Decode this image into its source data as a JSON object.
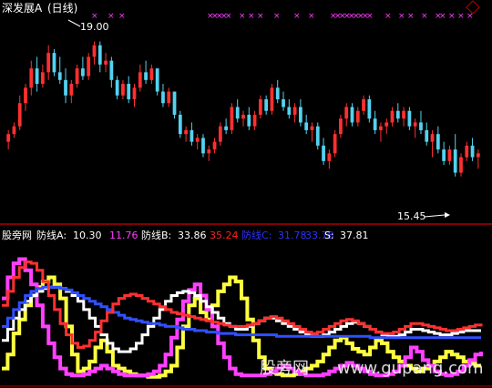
{
  "header": {
    "title": "深发展A",
    "period": "(日线)"
  },
  "chart_data": [
    {
      "type": "candlestick",
      "annotations": {
        "high_label": "19.00",
        "low_label": "15.45"
      },
      "markers": "×",
      "colors": {
        "up": "#ff3030",
        "down": "#54d2f0",
        "marker": "#ff3cff"
      },
      "yrange": [
        15.0,
        19.6
      ],
      "candles": [
        [
          16.4,
          16.7,
          16.2,
          16.6
        ],
        [
          16.6,
          16.9,
          16.5,
          16.8
        ],
        [
          16.8,
          17.6,
          16.7,
          17.4
        ],
        [
          17.4,
          17.9,
          17.2,
          17.8
        ],
        [
          17.8,
          18.5,
          17.6,
          18.3
        ],
        [
          18.3,
          18.6,
          17.7,
          17.9
        ],
        [
          17.9,
          18.4,
          17.8,
          18.2
        ],
        [
          18.2,
          18.9,
          18.0,
          18.7
        ],
        [
          18.7,
          18.8,
          18.1,
          18.2
        ],
        [
          18.2,
          18.6,
          17.9,
          18.0
        ],
        [
          18.0,
          18.3,
          17.4,
          17.6
        ],
        [
          17.6,
          18.0,
          17.4,
          17.9
        ],
        [
          17.9,
          18.4,
          17.8,
          18.3
        ],
        [
          18.3,
          18.6,
          18.0,
          18.1
        ],
        [
          18.1,
          18.7,
          18.0,
          18.6
        ],
        [
          18.6,
          19.0,
          18.4,
          18.9
        ],
        [
          18.9,
          19.0,
          18.2,
          18.4
        ],
        [
          18.4,
          18.7,
          18.2,
          18.5
        ],
        [
          18.5,
          18.6,
          17.8,
          18.0
        ],
        [
          18.0,
          18.1,
          17.5,
          17.6
        ],
        [
          17.6,
          18.0,
          17.5,
          17.9
        ],
        [
          17.9,
          18.1,
          17.4,
          17.5
        ],
        [
          17.5,
          17.9,
          17.3,
          17.8
        ],
        [
          17.8,
          18.4,
          17.7,
          18.2
        ],
        [
          18.2,
          18.5,
          17.9,
          18.0
        ],
        [
          18.0,
          18.4,
          17.9,
          18.3
        ],
        [
          18.3,
          18.3,
          17.6,
          17.7
        ],
        [
          17.7,
          17.9,
          17.3,
          17.4
        ],
        [
          17.4,
          17.8,
          17.3,
          17.7
        ],
        [
          17.7,
          17.7,
          17.0,
          17.1
        ],
        [
          17.1,
          17.2,
          16.5,
          16.6
        ],
        [
          16.6,
          16.8,
          16.4,
          16.7
        ],
        [
          16.7,
          16.9,
          16.3,
          16.4
        ],
        [
          16.4,
          16.6,
          16.2,
          16.5
        ],
        [
          16.5,
          16.6,
          16.0,
          16.1
        ],
        [
          16.1,
          16.3,
          15.9,
          16.2
        ],
        [
          16.2,
          16.5,
          16.1,
          16.4
        ],
        [
          16.4,
          16.9,
          16.3,
          16.8
        ],
        [
          16.8,
          17.0,
          16.6,
          16.7
        ],
        [
          16.7,
          17.4,
          16.6,
          17.3
        ],
        [
          17.3,
          17.5,
          16.9,
          17.0
        ],
        [
          17.0,
          17.2,
          16.8,
          17.1
        ],
        [
          17.1,
          17.3,
          16.7,
          16.8
        ],
        [
          16.8,
          17.2,
          16.7,
          17.1
        ],
        [
          17.1,
          17.6,
          17.0,
          17.5
        ],
        [
          17.5,
          17.6,
          17.1,
          17.2
        ],
        [
          17.2,
          17.9,
          17.1,
          17.8
        ],
        [
          17.8,
          18.0,
          17.4,
          17.5
        ],
        [
          17.5,
          17.7,
          17.2,
          17.3
        ],
        [
          17.3,
          17.5,
          17.0,
          17.1
        ],
        [
          17.1,
          17.4,
          16.9,
          17.3
        ],
        [
          17.3,
          17.5,
          16.8,
          16.9
        ],
        [
          16.9,
          17.1,
          16.6,
          16.7
        ],
        [
          16.7,
          16.9,
          16.4,
          16.8
        ],
        [
          16.8,
          16.9,
          16.2,
          16.3
        ],
        [
          16.3,
          16.5,
          15.8,
          15.9
        ],
        [
          15.9,
          16.2,
          15.7,
          16.1
        ],
        [
          16.1,
          16.7,
          16.0,
          16.6
        ],
        [
          16.6,
          17.1,
          16.5,
          17.0
        ],
        [
          17.0,
          17.4,
          16.8,
          17.3
        ],
        [
          17.3,
          17.4,
          16.8,
          16.9
        ],
        [
          16.9,
          17.3,
          16.8,
          17.2
        ],
        [
          17.2,
          17.6,
          17.1,
          17.5
        ],
        [
          17.5,
          17.6,
          16.9,
          17.0
        ],
        [
          17.0,
          17.2,
          16.6,
          16.7
        ],
        [
          16.7,
          16.9,
          16.4,
          16.8
        ],
        [
          16.8,
          17.0,
          16.6,
          16.9
        ],
        [
          16.9,
          17.3,
          16.8,
          17.2
        ],
        [
          17.2,
          17.4,
          16.9,
          17.0
        ],
        [
          17.0,
          17.3,
          16.8,
          17.2
        ],
        [
          17.2,
          17.3,
          16.7,
          16.8
        ],
        [
          16.8,
          17.0,
          16.5,
          16.9
        ],
        [
          16.9,
          17.2,
          16.6,
          16.7
        ],
        [
          16.7,
          16.9,
          16.3,
          16.4
        ],
        [
          16.4,
          16.7,
          16.0,
          16.6
        ],
        [
          16.6,
          16.8,
          16.1,
          16.2
        ],
        [
          16.2,
          16.4,
          15.8,
          15.9
        ],
        [
          15.9,
          16.3,
          15.8,
          16.2
        ],
        [
          16.2,
          16.6,
          15.5,
          15.6
        ],
        [
          15.6,
          16.1,
          15.5,
          16.0
        ],
        [
          16.0,
          16.4,
          15.9,
          16.3
        ],
        [
          16.3,
          16.5,
          15.9,
          16.0
        ],
        [
          16.0,
          16.2,
          15.7,
          16.1
        ]
      ]
    },
    {
      "type": "line",
      "legend": [
        {
          "name": "防线A:",
          "value": "10.30",
          "color": "#ffffff"
        },
        {
          "name": "",
          "value": "11.76",
          "color": "#ff3cff"
        },
        {
          "name": "防线B:",
          "value": "33.86",
          "color": "#ffffff"
        },
        {
          "name": "",
          "value": "35.24",
          "color": "#ff2020"
        },
        {
          "name": "防线C:",
          "value": "31.78",
          "color": "#3030ff"
        },
        {
          "name": "",
          "value": "33.78",
          "color": "#3030ff"
        },
        {
          "name": "S:",
          "value": "37.81",
          "color": "#ffffff"
        }
      ],
      "yrange": [
        0,
        100
      ],
      "series": [
        {
          "color": "#ffff40",
          "values": [
            10,
            20,
            35,
            45,
            55,
            62,
            68,
            72,
            75,
            70,
            60,
            40,
            20,
            8,
            10,
            15,
            25,
            30,
            22,
            12,
            10,
            8,
            6,
            5,
            5,
            4,
            4,
            5,
            8,
            12,
            25,
            40,
            55,
            60,
            50,
            45,
            55,
            65,
            70,
            75,
            72,
            60,
            45,
            30,
            18,
            10,
            8,
            6,
            5,
            5,
            6,
            8,
            10,
            12,
            15,
            20,
            25,
            30,
            32,
            28,
            24,
            22,
            20,
            25,
            30,
            28,
            22,
            18,
            15,
            12,
            10,
            8,
            10,
            12,
            15,
            18,
            22,
            20,
            18,
            15,
            14,
            12,
            12
          ]
        },
        {
          "color": "#ff40ff",
          "values": [
            60,
            75,
            85,
            88,
            80,
            70,
            55,
            40,
            28,
            18,
            10,
            6,
            5,
            5,
            6,
            8,
            10,
            12,
            10,
            8,
            6,
            5,
            5,
            5,
            5,
            6,
            8,
            12,
            20,
            32,
            45,
            58,
            66,
            70,
            62,
            52,
            40,
            28,
            18,
            10,
            6,
            5,
            5,
            5,
            5,
            6,
            8,
            10,
            12,
            10,
            8,
            6,
            5,
            5,
            5,
            6,
            8,
            10,
            12,
            14,
            12,
            10,
            8,
            6,
            5,
            5,
            6,
            8,
            12,
            18,
            25,
            22,
            16,
            12,
            8,
            6,
            5,
            6,
            8,
            12,
            16,
            20,
            22
          ]
        },
        {
          "color": "#ffffff",
          "values": [
            30,
            38,
            46,
            52,
            58,
            62,
            65,
            67,
            68,
            68,
            67,
            65,
            62,
            58,
            52,
            46,
            40,
            34,
            28,
            24,
            22,
            22,
            24,
            28,
            34,
            40,
            46,
            52,
            58,
            62,
            64,
            65,
            64,
            62,
            58,
            54,
            50,
            46,
            42,
            40,
            38,
            38,
            40,
            42,
            44,
            46,
            46,
            44,
            42,
            40,
            38,
            36,
            34,
            33,
            33,
            34,
            36,
            38,
            40,
            42,
            43,
            42,
            40,
            38,
            36,
            34,
            33,
            33,
            34,
            36,
            38,
            38,
            37,
            36,
            35,
            34,
            34,
            35,
            36,
            37,
            37,
            37,
            37
          ]
        },
        {
          "color": "#3050ff",
          "values": [
            40,
            46,
            52,
            57,
            62,
            65,
            67,
            68,
            68,
            68,
            67,
            66,
            64,
            62,
            60,
            58,
            56,
            54,
            52,
            50,
            48,
            46,
            45,
            44,
            43,
            42,
            42,
            41,
            40,
            40,
            39,
            38,
            38,
            37,
            37,
            36,
            36,
            35,
            35,
            35,
            34,
            34,
            34,
            34,
            34,
            34,
            34,
            33,
            33,
            33,
            33,
            33,
            33,
            33,
            33,
            33,
            33,
            33,
            33,
            33,
            33,
            33,
            33,
            32,
            32,
            32,
            32,
            32,
            32,
            32,
            32,
            32,
            32,
            32,
            32,
            32,
            32,
            32,
            32,
            32,
            32,
            32,
            32
          ]
        },
        {
          "color": "#ff3030",
          "values": [
            55,
            65,
            75,
            82,
            86,
            85,
            80,
            72,
            62,
            52,
            42,
            34,
            28,
            25,
            26,
            30,
            36,
            44,
            50,
            56,
            60,
            62,
            63,
            62,
            60,
            58,
            56,
            54,
            52,
            50,
            49,
            48,
            47,
            46,
            45,
            44,
            43,
            42,
            41,
            40,
            40,
            40,
            41,
            42,
            44,
            46,
            47,
            46,
            44,
            42,
            40,
            38,
            36,
            35,
            36,
            38,
            40,
            42,
            44,
            45,
            44,
            42,
            40,
            38,
            36,
            35,
            35,
            36,
            38,
            40,
            42,
            42,
            41,
            40,
            39,
            38,
            37,
            37,
            38,
            39,
            40,
            41,
            42
          ]
        }
      ]
    }
  ],
  "watermark": {
    "site_name": "股旁网",
    "url": "www.gupang.com"
  }
}
